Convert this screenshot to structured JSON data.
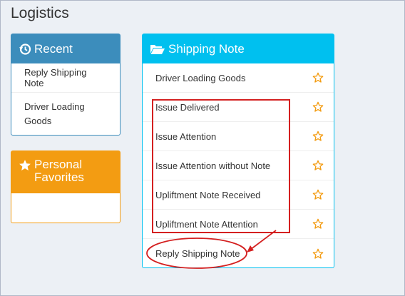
{
  "page": {
    "title": "Logistics"
  },
  "recent": {
    "title": "Recent",
    "icon": "history-icon",
    "items": [
      {
        "label": "Reply Shipping Note"
      },
      {
        "label": "Driver Loading Goods"
      }
    ]
  },
  "favorites": {
    "title": "Personal Favorites",
    "icon": "star-icon"
  },
  "shipping": {
    "title": "Shipping Note",
    "icon": "folder-open-icon",
    "items": [
      {
        "label": "Driver Loading Goods"
      },
      {
        "label": "Issue Delivered"
      },
      {
        "label": "Issue Attention"
      },
      {
        "label": "Issue Attention without Note"
      },
      {
        "label": "Upliftment Note Received"
      },
      {
        "label": "Upliftment Note Attention"
      },
      {
        "label": "Reply Shipping Note"
      }
    ]
  },
  "colors": {
    "recent": "#3c8dbc",
    "favorites": "#f39c12",
    "shipping": "#00c0ef",
    "star": "#f39c12",
    "annotation": "#d42020"
  }
}
